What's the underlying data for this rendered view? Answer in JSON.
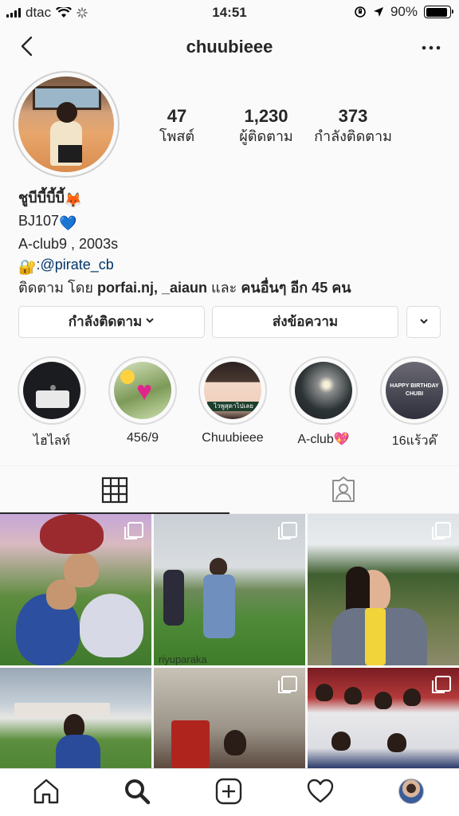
{
  "status_bar": {
    "carrier": "dtac",
    "time": "14:51",
    "battery": "90%",
    "battery_level": 0.9,
    "icons": [
      "signal-icon",
      "wifi-icon",
      "loading-icon",
      "orientation-lock-icon",
      "location-icon",
      "battery-icon"
    ]
  },
  "header": {
    "username": "chuubieee",
    "back_icon": "back-chevron-icon",
    "more_icon": "more-dots-icon"
  },
  "stats": [
    {
      "value": "47",
      "label": "โพสต์"
    },
    {
      "value": "1,230",
      "label": "ผู้ติดตาม"
    },
    {
      "value": "373",
      "label": "กำลังติดตาม"
    }
  ],
  "bio": {
    "name": "ชูบีบี้บี้บี้",
    "name_emoji": "🦊",
    "line1": "BJ107",
    "line1_emoji": "💙",
    "line2": "A-club9 , 2003s",
    "lock_emoji": "🔐",
    "link_prefix": ":",
    "link": "@pirate_cb",
    "followed_by_prefix": "ติดตาม โดย",
    "followed_by_names": "porfai.nj, _aiaun",
    "followed_by_and": "และ",
    "followed_by_others": "คนอื่นๆ อีก 45 คน"
  },
  "actions": {
    "following": "กำลังติดตาม",
    "message": "ส่งข้อความ"
  },
  "highlights": [
    {
      "label": "ไฮไลท์"
    },
    {
      "label": "456/9"
    },
    {
      "label": "Chuubieee"
    },
    {
      "label": "A-club",
      "emoji": "💖"
    },
    {
      "label": "16แร้วค๊"
    }
  ],
  "highlight_texts": {
    "chuubieee_banner": "ไวพูสุดาไปเลย",
    "birthday": "HAPPY BIRTHDAY",
    "birthday_name": "CHUBI"
  },
  "tabs": [
    "grid-icon",
    "tagged-icon"
  ],
  "photos": {
    "watermark": "riyuparaka"
  },
  "bottom_nav": [
    "home-icon",
    "search-icon",
    "add-post-icon",
    "heart-icon",
    "profile-avatar"
  ],
  "colors": {
    "link": "#003569",
    "border": "#dbdbdb",
    "background": "#fafafa",
    "text": "#262626"
  }
}
